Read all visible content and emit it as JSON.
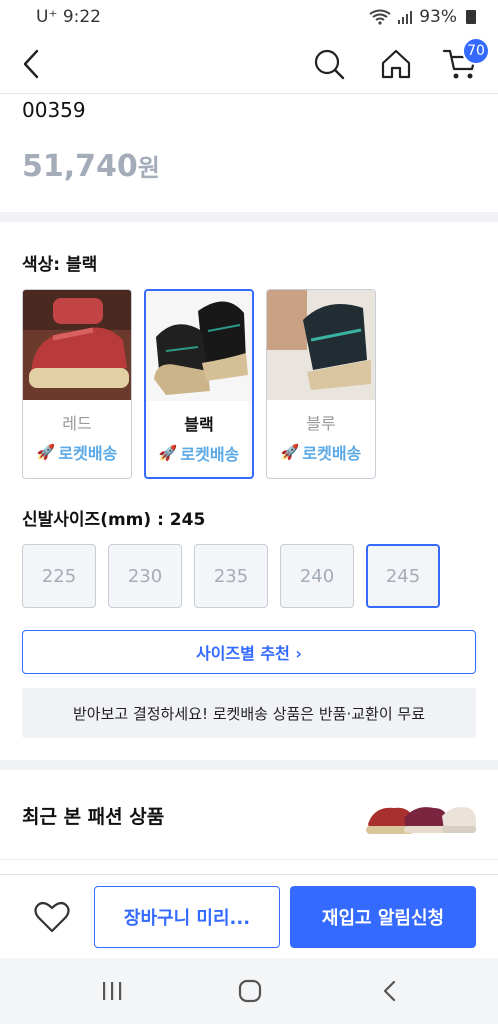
{
  "status_bar": {
    "carrier": "U⁺ 9:22",
    "battery": "93%"
  },
  "header": {
    "cart_count": "70",
    "icons": [
      "back-icon",
      "search-icon",
      "home-icon",
      "cart-icon"
    ]
  },
  "product": {
    "code": "00359",
    "price": "51,740",
    "currency": "원"
  },
  "color_option": {
    "label": "색상: 블랙",
    "swatches": [
      {
        "name": "레드",
        "delivery": "로켓배송",
        "selected": false
      },
      {
        "name": "블랙",
        "delivery": "로켓배송",
        "selected": true
      },
      {
        "name": "블루",
        "delivery": "로켓배송",
        "selected": false
      }
    ]
  },
  "size_option": {
    "label": "신발사이즈(mm) : 245",
    "sizes": [
      "225",
      "230",
      "235",
      "240",
      "245"
    ],
    "selected": "245"
  },
  "recommend_button": "사이즈별 추천 ›",
  "notice": "받아보고 결정하세요! 로켓배송 상품은 반품·교환이 무료",
  "recent": {
    "title": "최근 본 패션 상품"
  },
  "bottom_bar": {
    "cart_button": "장바구니 미리...",
    "restock_button": "재입고 알림신청"
  },
  "colors": {
    "accent": "#346aff",
    "price_grey": "#a4acb9",
    "rocket": "#5aa9e6"
  }
}
